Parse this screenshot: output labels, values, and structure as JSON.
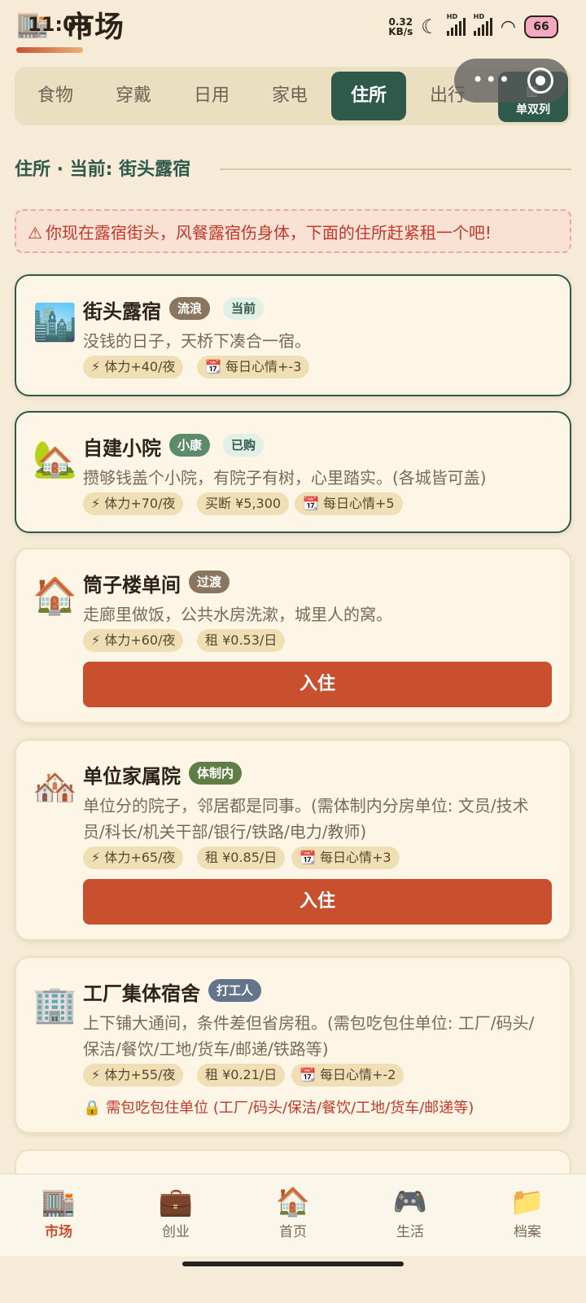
{
  "status_bar": {
    "time": "11:03",
    "net_speed_value": "0.32",
    "net_speed_unit": "KB/s",
    "signal_label": "HD",
    "battery": "66"
  },
  "header": {
    "title": "市场"
  },
  "tabs": [
    {
      "label": "食物"
    },
    {
      "label": "穿戴"
    },
    {
      "label": "日用"
    },
    {
      "label": "家电"
    },
    {
      "label": "住所"
    },
    {
      "label": "出行"
    }
  ],
  "view_toggle": {
    "label": "单双列"
  },
  "section": {
    "title": "住所 · 当前: 街头露宿"
  },
  "warning": {
    "text": "你现在露宿街头，风餐露宿伤身体，下面的住所赶紧租一个吧!"
  },
  "cards": [
    {
      "icon": "🏙️",
      "name": "街头露宿",
      "badge": "流浪",
      "status": "当前",
      "desc": "没钱的日子，天桥下凑合一宿。",
      "chips": [
        "⚡ 体力+40/夜",
        "📆 每日心情+-3"
      ]
    },
    {
      "icon": "🏡",
      "name": "自建小院",
      "badge": "小康",
      "status": "已购",
      "desc": "攒够钱盖个小院，有院子有树，心里踏实。(各城皆可盖)",
      "chips": [
        "⚡ 体力+70/夜",
        "买断 ¥5,300",
        "📆 每日心情+5"
      ]
    },
    {
      "icon": "🏠",
      "name": "筒子楼单间",
      "badge": "过渡",
      "desc": "走廊里做饭，公共水房洗漱，城里人的窝。",
      "chips": [
        "⚡ 体力+60/夜",
        "租 ¥0.53/日"
      ],
      "button": "入住"
    },
    {
      "icon": "🏘️",
      "name": "单位家属院",
      "badge": "体制内",
      "desc": "单位分的院子，邻居都是同事。(需体制内分房单位: 文员/技术员/科长/机关干部/银行/铁路/电力/教师)",
      "chips": [
        "⚡ 体力+65/夜",
        "租 ¥0.85/日",
        "📆 每日心情+3"
      ],
      "button": "入住"
    },
    {
      "icon": "🏢",
      "name": "工厂集体宿舍",
      "badge": "打工人",
      "desc": "上下铺大通间，条件差但省房租。(需包吃包住单位: 工厂/码头/保洁/餐饮/工地/货车/邮递/铁路等)",
      "chips": [
        "⚡ 体力+55/夜",
        "租 ¥0.21/日",
        "📆 每日心情+-2"
      ],
      "note": "🔒 需包吃包住单位 (工厂/码头/保洁/餐饮/工地/货车/邮递等)"
    }
  ],
  "bottom_nav": [
    {
      "icon": "🏬",
      "label": "市场"
    },
    {
      "icon": "💼",
      "label": "创业"
    },
    {
      "icon": "🏠",
      "label": "首页"
    },
    {
      "icon": "🎮",
      "label": "生活"
    },
    {
      "icon": "📁",
      "label": "档案"
    }
  ]
}
